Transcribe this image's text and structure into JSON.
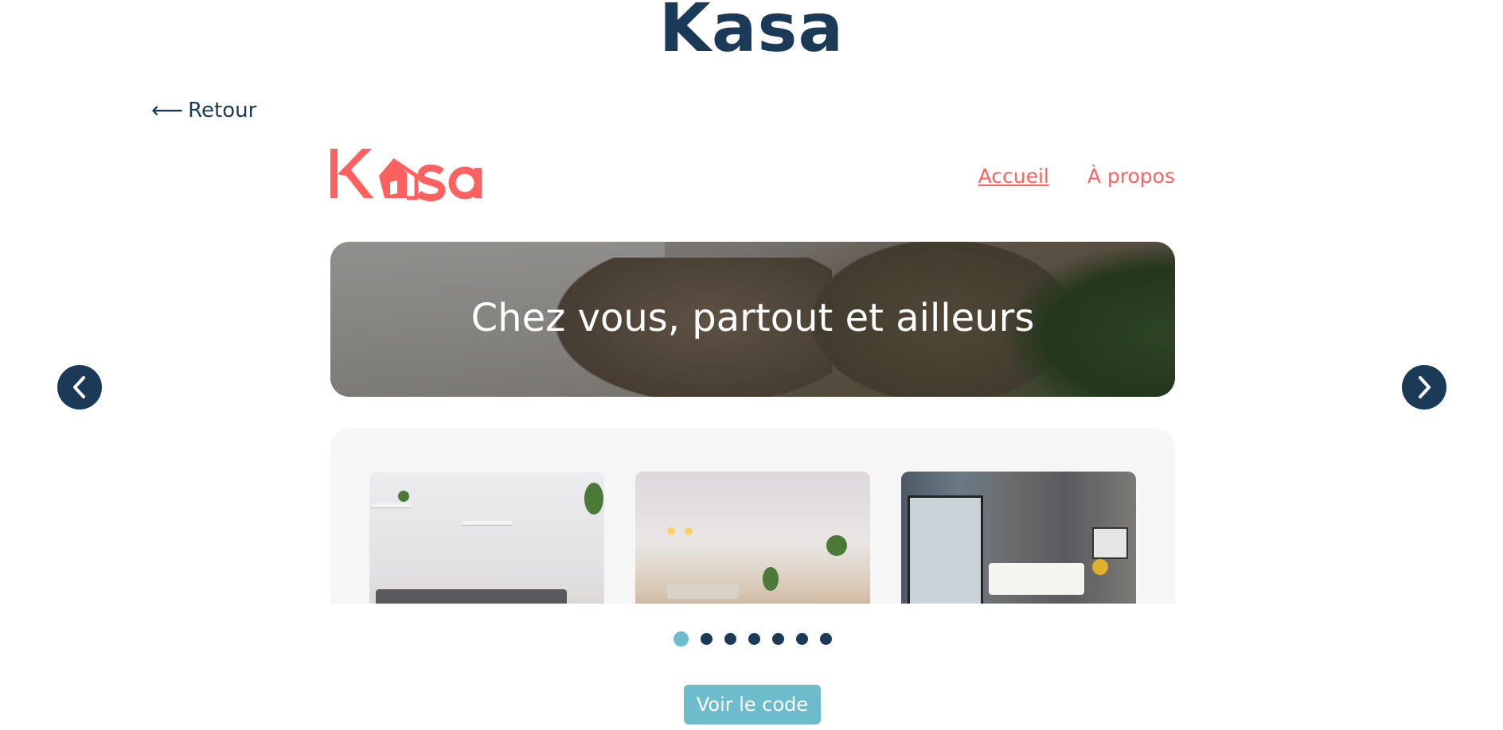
{
  "header": {
    "title": "Kasa"
  },
  "back": {
    "arrow": "⟵",
    "label": "Retour"
  },
  "carousel": {
    "prev_icon": "chevron-left-icon",
    "next_icon": "chevron-right-icon",
    "total_slides": 7,
    "active_slide": 1
  },
  "site": {
    "logo_text": "Kasa",
    "nav": [
      {
        "label": "Accueil",
        "active": true
      },
      {
        "label": "À propos",
        "active": false
      }
    ],
    "banner_text": "Chez vous, partout et ailleurs",
    "cards": [
      "living-room-photo",
      "open-plan-room-photo",
      "bedroom-photo"
    ]
  },
  "cta": {
    "label": "Voir le code"
  },
  "colors": {
    "primary": "#1b3a57",
    "accent": "#ff6060",
    "teal": "#6cbccb"
  }
}
